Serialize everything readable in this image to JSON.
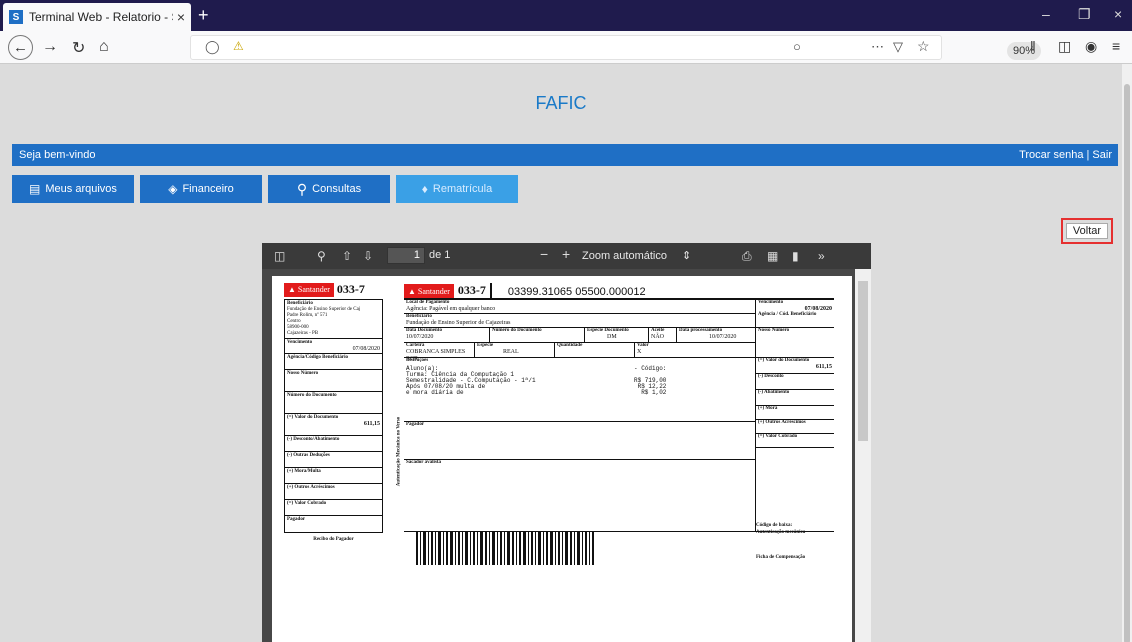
{
  "browser": {
    "tab_title": "Terminal Web - Relatorio - Sop",
    "tab_close": "×",
    "favicon": "S",
    "new_tab": "+",
    "zoom": "90%",
    "win_min": "–",
    "win_restore": "❐",
    "win_close": "×"
  },
  "site": {
    "title": "FAFIC",
    "welcome": "Seja bem-vindo",
    "account_links": "Trocar senha | Sair",
    "menu": [
      {
        "label": "Meus arquivos",
        "icon": "inbox-icon"
      },
      {
        "label": "Financeiro",
        "icon": "money-icon"
      },
      {
        "label": "Consultas",
        "icon": "search-icon"
      },
      {
        "label": "Rematrícula",
        "icon": "comments-icon"
      }
    ],
    "back_button": "Voltar"
  },
  "pdf_viewer": {
    "page_current": "1",
    "page_total": "de 1",
    "zoom_mode": "Zoom automático"
  },
  "boleto": {
    "bank_name": "Santander",
    "bank_code": "033-7",
    "digitable_line": "03399.31065  05500.000012",
    "stub": {
      "beneficiary_label": "Beneficiário",
      "beneficiary_lines": [
        "Fundação de Ensino Superior de Caj",
        "Padre Rolim, nº 571",
        "Centro",
        "58900-000",
        "Cajazeiras - PB"
      ],
      "due_label": "Vencimento",
      "due_value": "07/08/2020",
      "agency_label": "Agência/Código Beneficiário",
      "our_number_label": "Nosso Número",
      "doc_number_label": "Número do Documento",
      "doc_value_label": "(=) Valor do Documento",
      "doc_value": "611,15",
      "discount_label": "(-) Desconto/Abatimento",
      "deductions_label": "(-) Outras Deduções",
      "fine_label": "(+) Mora/Multa",
      "additions_label": "(+) Outros Acréscimos",
      "charged_label": "(=) Valor Cobrado",
      "payer_label": "Pagador",
      "footer": "Recibo do Pagador",
      "vertical_text": "Autenticação Mecânica no Verso"
    },
    "main": {
      "payment_place_label": "Local de Pagamento",
      "payment_place": "Agência:  Pagável em qualquer banco",
      "beneficiary_label": "Beneficiário",
      "beneficiary": "Fundação de Ensino Superior de Cajazeiras",
      "doc_date_label": "Data Documento",
      "doc_date": "10/07/2020",
      "doc_number_label": "Número do Documento",
      "species_doc_label": "Espécie Documento",
      "species_doc": "DM",
      "accept_label": "Aceite",
      "accept": "NÃO",
      "processing_date_label": "Data processamento",
      "processing_date": "10/07/2020",
      "wallet_label": "Carteira",
      "wallet": "COBRANCA SIMPLES RCR",
      "species_label": "Espécie",
      "species": "REAL",
      "quantity_label": "Quantidade",
      "quantity": "X",
      "value_label": "Valor",
      "instructions_label": "Instruções",
      "instructions": "Aluno(a):\nTurma: Ciência da Computação 1\nSemestralidade - C.Computação - 1ª/1\nApós 07/08/20 multa de\ne mora diária de",
      "instructions_right": "- Código:\n\nR$ 719,00\nR$ 12,22\nR$ 1,02",
      "payer_label": "Pagador",
      "guarantor_label": "Sacador avalista",
      "due_label": "Vencimento",
      "due_value": "07/08/2020",
      "agency_label": "Agência / Cód. Beneficiário",
      "our_number_label": "Nosso Número",
      "doc_value_label": "(=) Valor do Documento",
      "doc_value": "611,15",
      "discount_label": "(-) Desconto",
      "abatement_label": "(-) Abatimento",
      "fine_label": "(+) Mora",
      "additions_label": "(+) Outros Acréscimos",
      "charged_label": "(=) Valor Cobrado",
      "drop_code_label": "Código de baixa:",
      "mech_auth_label": "Autenticação mecânica",
      "comp_slip_label": "Ficha de Compensação"
    }
  }
}
